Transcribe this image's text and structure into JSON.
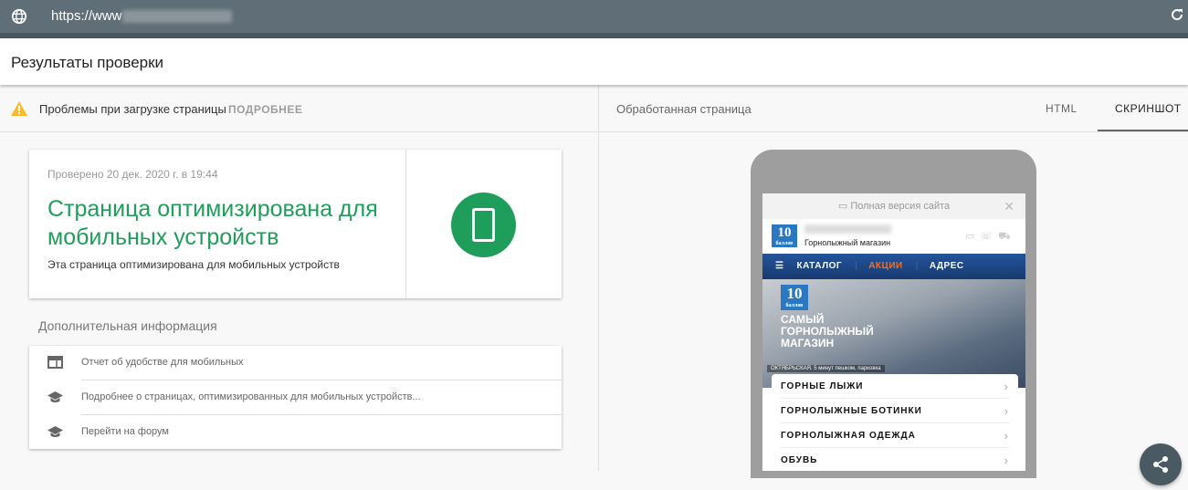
{
  "browser": {
    "url": "https://www"
  },
  "header": {
    "title": "Результаты проверки"
  },
  "warning": {
    "text": "Проблемы при загрузке страницы",
    "more": "ПОДРОБНЕЕ"
  },
  "right": {
    "label": "Обработанная страница",
    "tabs": [
      "HTML",
      "СКРИНШОТ"
    ],
    "active_tab": "СКРИНШОТ"
  },
  "result": {
    "checked": "Проверено 20 дек. 2020 г. в 19:44",
    "title": "Страница оптимизирована для мобильных устройств",
    "subtitle": "Эта страница оптимизирована для мобильных устройств",
    "accent": "#1e9e5a"
  },
  "additional": {
    "heading": "Дополнительная информация",
    "items": [
      "Отчет об удобстве для мобильных",
      "Подробнее о страницах, оптимизированных для мобильных устройств...",
      "Перейти на форум"
    ]
  },
  "screenshot": {
    "banner": "Полная версия сайта",
    "logo": "10",
    "logo_sub": "баллов",
    "tagline": "Горнолыжный магазин",
    "nav": [
      "КАТАЛОГ",
      "АКЦИИ",
      "АДРЕС"
    ],
    "slogan": [
      "САМЫЙ",
      "ГОРНОЛЫЖНЫЙ",
      "МАГАЗИН"
    ],
    "metro": "ОКТЯБРЬСКАЯ. 5 минут пешком, парковка",
    "menu": [
      "ГОРНЫЕ ЛЫЖИ",
      "ГОРНОЛЫЖНЫЕ БОТИНКИ",
      "ГОРНОЛЫЖНАЯ ОДЕЖДА",
      "ОБУВЬ"
    ]
  }
}
